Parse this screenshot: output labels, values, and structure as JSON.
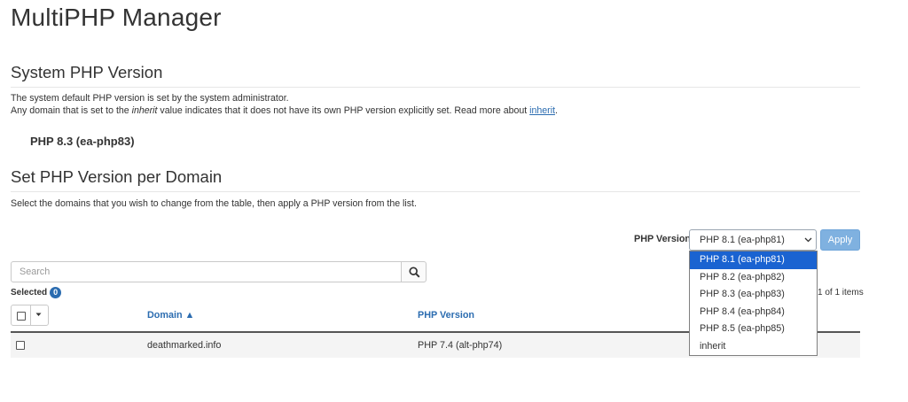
{
  "page": {
    "title": "MultiPHP Manager"
  },
  "system_section": {
    "heading": "System PHP Version",
    "line1": "The system default PHP version is set by the system administrator.",
    "line2_prefix": "Any domain that is set to the ",
    "line2_em": "inherit",
    "line2_suffix": " value indicates that it does not have its own PHP version explicitly set. Read more about ",
    "line2_link": "inherit",
    "line2_end": ".",
    "current_version": "PHP 8.3 (ea-php83)"
  },
  "domain_section": {
    "heading": "Set PHP Version per Domain",
    "description": "Select the domains that you wish to change from the table, then apply a PHP version from the list."
  },
  "php_select": {
    "label": "PHP Version",
    "selected": "PHP 8.1 (ea-php81)",
    "options": [
      "PHP 8.1 (ea-php81)",
      "PHP 8.2 (ea-php82)",
      "PHP 8.3 (ea-php83)",
      "PHP 8.4 (ea-php84)",
      "PHP 8.5 (ea-php85)",
      "inherit"
    ]
  },
  "apply_button": {
    "label": "Apply"
  },
  "search": {
    "placeholder": "Search",
    "icon": "magnifier-icon"
  },
  "selection": {
    "label": "Selected",
    "count": "0"
  },
  "pagination": {
    "text": "1 of 1 items"
  },
  "table": {
    "columns": {
      "domain": "Domain ▲",
      "php_version": "PHP Version"
    },
    "rows": [
      {
        "domain": "deathmarked.info",
        "php_version": "PHP 7.4 (alt-php74)"
      }
    ]
  },
  "colors": {
    "accent": "#2b6cb0",
    "dropdown_highlight": "#1a63d1",
    "apply_button": "#7fb1e0"
  }
}
